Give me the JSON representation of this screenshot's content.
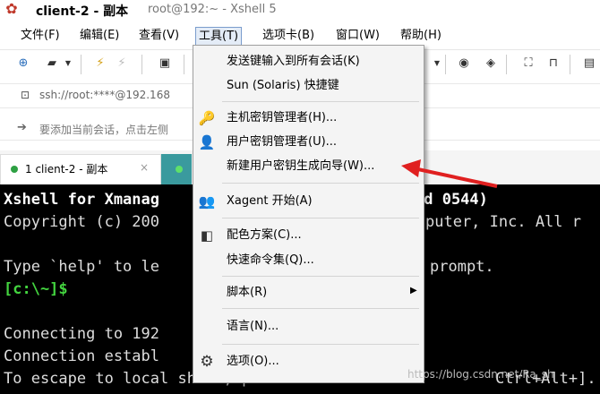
{
  "window": {
    "title": "client-2 - 副本",
    "subtitle": "root@192:~ - Xshell 5"
  },
  "menubar": [
    "文件(F)",
    "编辑(E)",
    "查看(V)",
    "工具(T)",
    "选项卡(B)",
    "窗口(W)",
    "帮助(H)"
  ],
  "address": {
    "text": "ssh://root:****@192.168"
  },
  "hint": {
    "text": "要添加当前会话，点击左侧"
  },
  "tabs": [
    {
      "label": "1 client-2 - 副本",
      "close": "×"
    }
  ],
  "terminal": {
    "lines": [
      "Xshell for Xmanag",
      "Copyright (c) 200",
      "",
      "Type `help' to le",
      "[c:\\~]$",
      "",
      "Connecting to 192",
      "Connection establ",
      "To escape to local shell, press"
    ],
    "right_lines": [
      "ld 0544)",
      "puter, Inc. All r",
      "",
      "prompt.",
      "",
      "",
      "",
      "",
      "Ctrl+Alt+]."
    ]
  },
  "tools_menu": {
    "items": [
      {
        "label": "发送键输入到所有会话(K)",
        "icon": ""
      },
      {
        "label": "Sun (Solaris) 快捷键",
        "icon": ""
      },
      {
        "label": "主机密钥管理者(H)...",
        "icon": "host-key-icon"
      },
      {
        "label": "用户密钥管理者(U)...",
        "icon": "user-key-icon"
      },
      {
        "label": "新建用户密钥生成向导(W)...",
        "icon": ""
      },
      {
        "label": "Xagent 开始(A)",
        "icon": "xagent-icon"
      },
      {
        "label": "配色方案(C)...",
        "icon": "color-scheme-icon"
      },
      {
        "label": "快速命令集(Q)...",
        "icon": ""
      },
      {
        "label": "脚本(R)",
        "icon": "",
        "submenu": true
      },
      {
        "label": "语言(N)...",
        "icon": ""
      },
      {
        "label": "选项(O)...",
        "icon": "gear-icon"
      }
    ]
  },
  "watermark": "https://blog.csdn.net/Ra_sh",
  "colors": {
    "accent": "#e02020",
    "prompt": "#43d43f",
    "terminal_bg": "#000000"
  }
}
